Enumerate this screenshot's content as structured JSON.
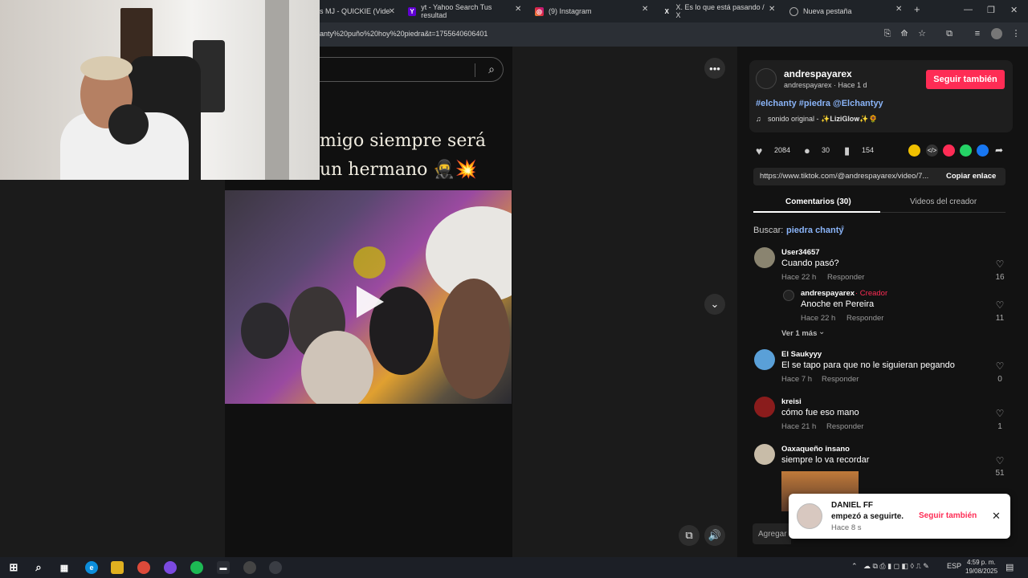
{
  "browser": {
    "tabs": [
      {
        "title": "s MJ - QUICKIE (Vide",
        "icon": "video-tab-icon"
      },
      {
        "title": "yt - Yahoo Search Tus resultad",
        "icon": "yahoo-icon"
      },
      {
        "title": "(9) Instagram",
        "icon": "instagram-icon"
      },
      {
        "title": "X. Es lo que está pasando / X",
        "icon": "x-icon"
      },
      {
        "title": "Nueva pestaña",
        "icon": "chrome-icon"
      }
    ],
    "new_tab": "+",
    "url": "anty%20puño%20hoy%20piedra&t=1755640606401"
  },
  "video": {
    "caption": "migo siempre será un hermano 🥷💥"
  },
  "post": {
    "author_handle": "andrespayarex",
    "author_sub": "andrespayarex · Hace 1 d",
    "follow_label": "Seguir también",
    "hashtags": "#elchanty #piedra @Elchantyy",
    "sound": "sonido original - ✨𝐋𝐢𝐳𝐢𝐆𝐥𝐨𝐰✨🌻",
    "likes": "2084",
    "comments": "30",
    "saves": "154",
    "link": "https://www.tiktok.com/@andrespayarex/video/7...",
    "copy_label": "Copiar enlace",
    "tab_comments": "Comentarios (30)",
    "tab_videos": "Videos del creador",
    "search_prefix": "Buscar:",
    "search_term": "piedra chanty"
  },
  "comments": [
    {
      "user": "User34657",
      "text": "Cuando pasó?",
      "time": "Hace 22 h",
      "reply": "Responder",
      "likes": "16"
    },
    {
      "user": "andrespayarex",
      "creator_tag": "· Creador",
      "text": "Anoche en Pereira",
      "time": "Hace 22 h",
      "reply": "Responder",
      "likes": "11"
    },
    {
      "user": "El Saukyyy",
      "text": "El se tapo para que no le siguieran pegando",
      "time": "Hace 7 h",
      "reply": "Responder",
      "likes": "0"
    },
    {
      "user": "kreisi",
      "text": "cómo fue eso mano",
      "time": "Hace 21 h",
      "reply": "Responder",
      "likes": "1"
    },
    {
      "user": "Oaxaqueño insano",
      "text": "siempre lo va recordar",
      "likes": "51"
    }
  ],
  "more_replies": "Ver 1 más",
  "add_comment": "Agregar",
  "toast": {
    "name": "DANIEL FF",
    "msg": "empezó a seguirte.",
    "time": "Hace 8 s",
    "action": "Seguir también"
  },
  "taskbar": {
    "lang": "ESP",
    "time": "4:59 p. m.",
    "date": "19/08/2025"
  },
  "colors": {
    "accent": "#fe2c55",
    "link": "#8ab4f8"
  }
}
